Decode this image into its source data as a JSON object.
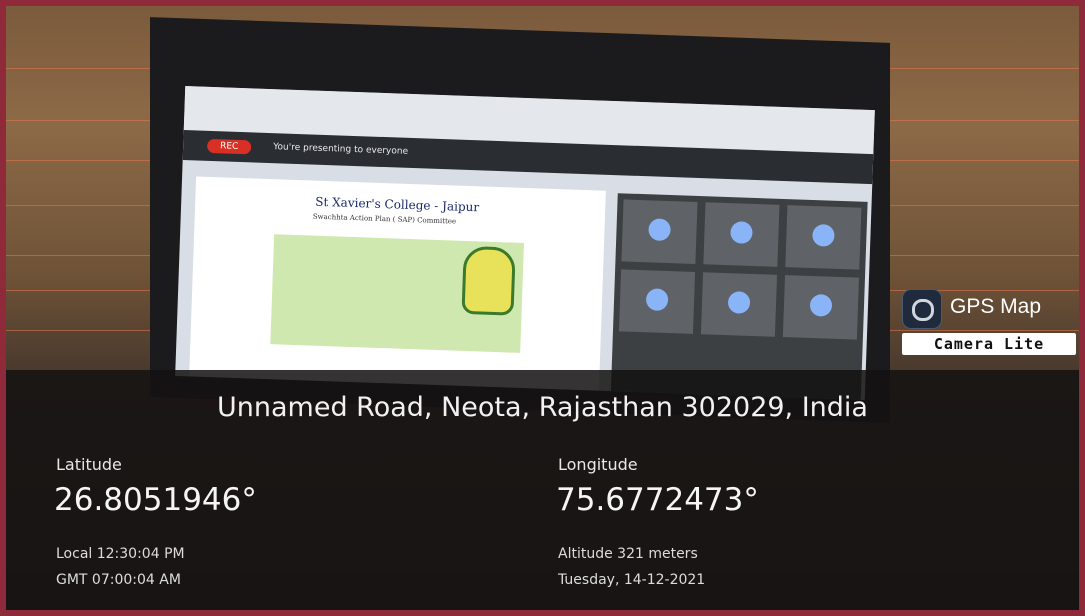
{
  "photo": {
    "screen": {
      "rec_label": "REC",
      "presenting_text": "You're presenting to everyone",
      "slide_title": "St Xavier's College - Jaipur",
      "slide_subtitle": "Swachhta Action Plan ( SAP) Committee"
    }
  },
  "gps_badge": {
    "icon": "camera-lens-icon",
    "title": "GPS Map",
    "subtitle": "Camera Lite"
  },
  "location": {
    "address": "Unnamed Road, Neota, Rajasthan 302029, India",
    "latitude_label": "Latitude",
    "latitude_value": "26.8051946°",
    "longitude_label": "Longitude",
    "longitude_value": "75.6772473°",
    "local_time": "Local 12:30:04 PM",
    "gmt_time": "GMT 07:00:04 AM",
    "altitude": "Altitude 321 meters",
    "date": "Tuesday, 14-12-2021"
  },
  "colors": {
    "frame_border": "#8e2a3a",
    "overlay": "#141212"
  }
}
